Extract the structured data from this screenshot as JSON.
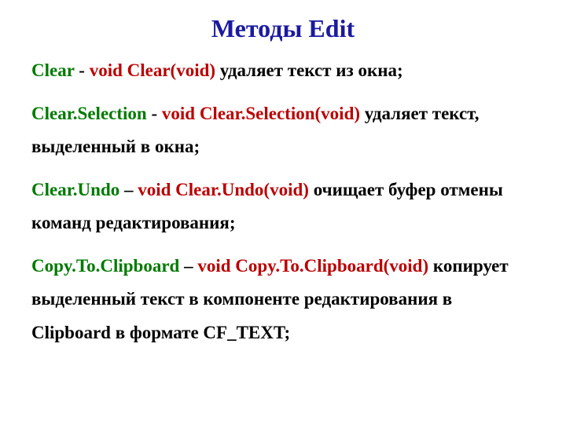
{
  "title": "Методы Edit",
  "methods": [
    {
      "name": "Clear",
      "sep": " - ",
      "sig": "void Clear(void)",
      "desc": " удаляет текст из окна;"
    },
    {
      "name": "Clear.Selection",
      "sep": " - ",
      "sig": "void Clear.Selection(void)",
      "desc": " удаляет текст, выделенный в окна;"
    },
    {
      "name": "Clear.Undo",
      "sep": " – ",
      "sig": "void Clear.Undo(void)",
      "desc": " очищает буфер отмены команд редактирования;"
    },
    {
      "name": "Copy.To.Clipboard",
      "sep": " – ",
      "sig": "void Copy.To.Clipboard(void)",
      "desc": " копирует выделенный текст в компоненте редактирования в Clipboard в формате CF_TEXT;"
    }
  ]
}
